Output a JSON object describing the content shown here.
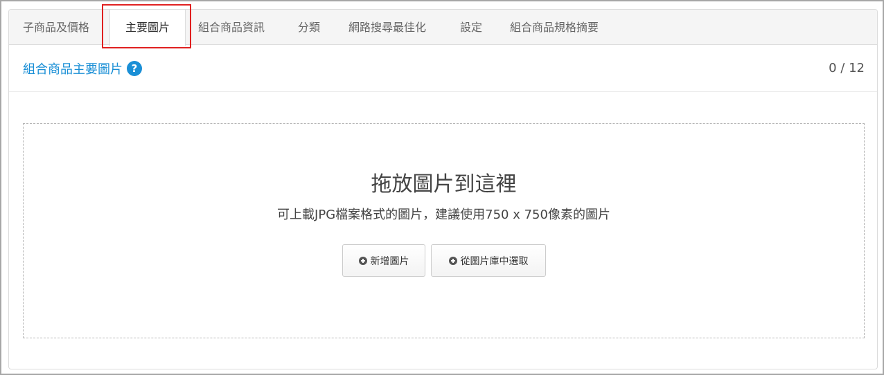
{
  "tabs": [
    {
      "label": "子商品及價格"
    },
    {
      "label": "主要圖片",
      "active": true
    },
    {
      "label": "組合商品資訊"
    },
    {
      "label": "分類"
    },
    {
      "label": "網路搜尋最佳化"
    },
    {
      "label": "設定"
    },
    {
      "label": "組合商品規格摘要"
    }
  ],
  "section": {
    "title": "組合商品主要圖片",
    "help_icon": "question-circle-icon",
    "help_glyph": "?",
    "counter": "0 / 12"
  },
  "dropzone": {
    "title": "拖放圖片到這裡",
    "subtitle": "可上載JPG檔案格式的圖片，建議使用750 x 750像素的圖片",
    "add_button": {
      "label": "新增圖片",
      "icon": "plus-circle-icon"
    },
    "library_button": {
      "label": "從圖片庫中選取",
      "icon": "plus-circle-icon"
    }
  },
  "colors": {
    "accent": "#1a8fd6",
    "highlight": "#e02020"
  }
}
